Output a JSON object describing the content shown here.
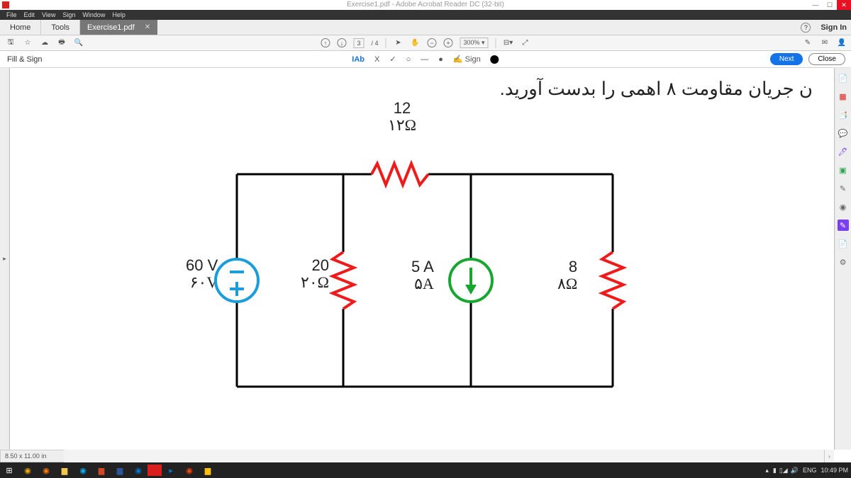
{
  "app": {
    "title": "Exercise1.pdf - Adobe Acrobat Reader DC (32-bit)"
  },
  "menu": {
    "file": "File",
    "edit": "Edit",
    "view": "View",
    "sign": "Sign",
    "window": "Window",
    "help": "Help"
  },
  "tabs": {
    "home": "Home",
    "tools": "Tools",
    "filename": "Exercise1.pdf",
    "signin": "Sign In"
  },
  "toolbar": {
    "page_current": "3",
    "page_sep": "/ 4",
    "zoom": "300%"
  },
  "fillsign": {
    "label": "Fill & Sign",
    "iab": "IAb",
    "sign": "Sign",
    "next": "Next",
    "close": "Close"
  },
  "status": {
    "dim": "8.50 x 11.00 in"
  },
  "tray": {
    "lang": "ENG",
    "time": "10:49 PM"
  },
  "doc": {
    "question": "ن جریان مقاومت ۸ اهمی را بدست آورید.",
    "r12": "12",
    "r12p": "۱۲Ω",
    "v60": "60 V",
    "v60p": "۶۰V",
    "r20": "20",
    "r20p": "۲۰Ω",
    "i5": "5 A",
    "i5p": "۵A",
    "r8": "8",
    "r8p": "۸Ω"
  }
}
